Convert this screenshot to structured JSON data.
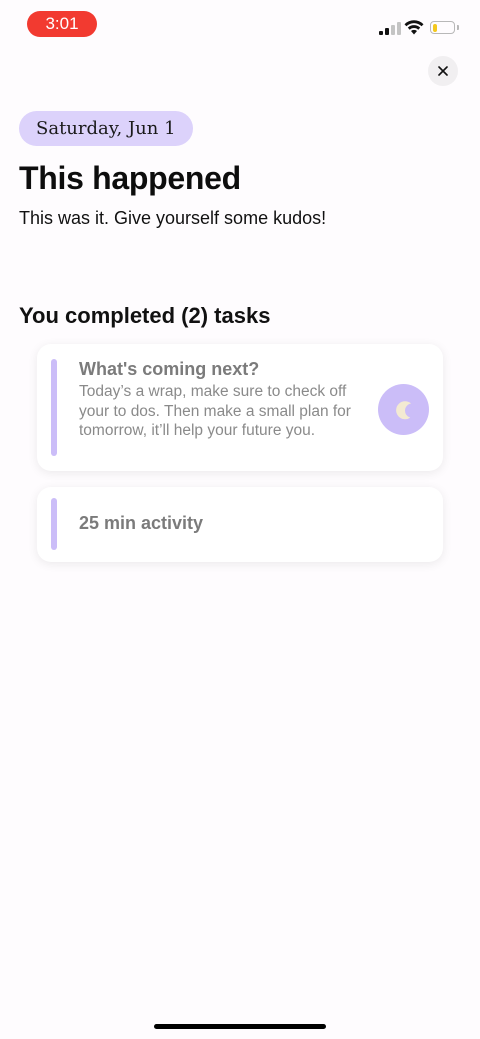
{
  "status_bar": {
    "time": "3:01",
    "time_pill_color": "#f23a30",
    "battery_color": "#f4c81e",
    "signal_icon": "cellular-signal-icon",
    "wifi_icon": "wifi-icon",
    "battery_icon": "battery-low-icon"
  },
  "header": {
    "close_icon": "close-icon",
    "date_chip": "Saturday, Jun 1",
    "title": "This happened",
    "subtitle": "This was it. Give yourself some kudos!"
  },
  "accent_color": "#cbbdf8",
  "section": {
    "title": "You completed (2) tasks"
  },
  "tasks": [
    {
      "title": "What's coming next?",
      "description": "Today’s a wrap, make sure to check off your to dos. Then make a small plan for tomorrow, it’ll help your future you.",
      "icon": "moon-icon"
    },
    {
      "title": "25 min activity"
    }
  ]
}
